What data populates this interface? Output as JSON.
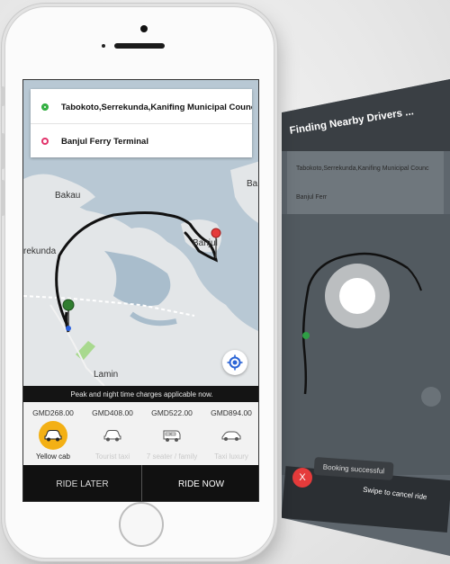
{
  "route": {
    "pickup": "Tabokoto,Serrekunda,Kanifing Municipal Council",
    "dropoff": "Banjul Ferry Terminal"
  },
  "map_labels": {
    "bakau": "Bakau",
    "serrekunda": "rekunda",
    "banjul": "Banjul",
    "lamin": "Lamin",
    "ba_edge": "Ba"
  },
  "notice": "Peak and night time charges applicable now.",
  "cab_options": [
    {
      "price": "GMD268.00",
      "name": "Yellow cab",
      "icon": "car-icon",
      "selected": true
    },
    {
      "price": "GMD408.00",
      "name": "Tourist taxi",
      "icon": "car-icon",
      "selected": false
    },
    {
      "price": "GMD522.00",
      "name": "7 seater / family",
      "icon": "van-icon",
      "selected": false
    },
    {
      "price": "GMD894.00",
      "name": "Taxi luxury",
      "icon": "car-icon",
      "selected": false
    }
  ],
  "actions": {
    "ride_later": "RIDE LATER",
    "ride_now": "RIDE NOW"
  },
  "second_screen": {
    "title": "Finding Nearby Drivers ...",
    "pickup": "Tabokoto,Serrekunda,Kanifing Municipal Counc",
    "dropoff": "Banjul Ferr",
    "toast": "Booking successful",
    "swipe_text": "Swipe to cancel ride",
    "cancel_symbol": "X"
  },
  "colors": {
    "accent_yellow": "#f3b015",
    "pickup_green": "#2fae3e",
    "dropoff_red": "#e2336b",
    "route_line": "#111111",
    "cancel_red": "#e53b3b"
  }
}
